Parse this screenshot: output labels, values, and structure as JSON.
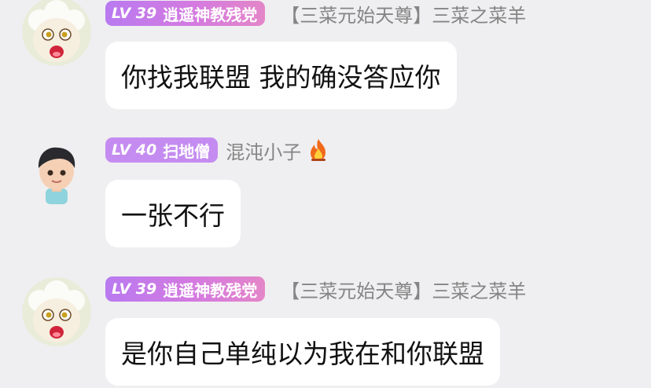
{
  "messages": [
    {
      "level": "LV 39",
      "badge_text": "逍遥神教残党",
      "username": "【三菜元始天尊】三菜之菜羊",
      "text": "你找我联盟 我的确没答应你"
    },
    {
      "level": "LV 40",
      "badge_text": "扫地僧",
      "username": "混沌小子",
      "text": "一张不行"
    },
    {
      "level": "LV 39",
      "badge_text": "逍遥神教残党",
      "username": "【三菜元始天尊】三菜之菜羊",
      "text": "是你自己单纯以为我在和你联盟"
    }
  ],
  "icons": {
    "sheep_avatar": "sheep-avatar-icon",
    "boy_avatar": "boy-avatar-icon",
    "fire": "fire-icon"
  },
  "colors": {
    "background": "#efeff1",
    "bubble": "#ffffff",
    "badge_pink": "#d47ae0",
    "badge_purple": "#c48cf0",
    "username": "#858585"
  }
}
